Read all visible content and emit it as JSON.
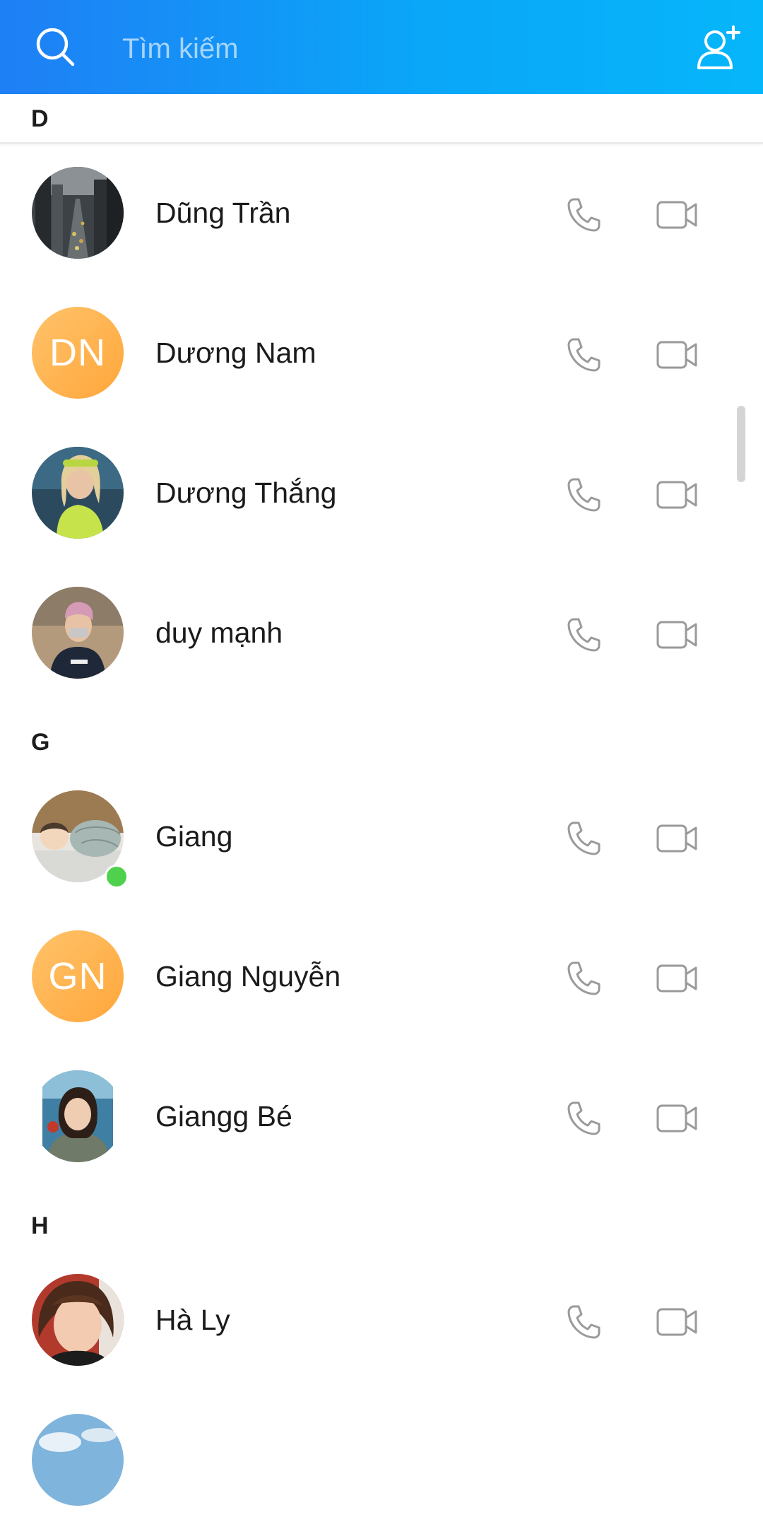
{
  "header": {
    "search_placeholder": "Tìm kiếm",
    "search_icon": "search-icon",
    "add_friend_icon": "add-friend-icon",
    "gradient_start": "#1f7ff5",
    "gradient_end": "#06b6fa"
  },
  "sections": [
    {
      "letter": "D",
      "contacts": [
        {
          "name": "Dũng Trần",
          "avatar": "photo"
        },
        {
          "name": "Dương Nam",
          "avatar": "initials",
          "initials": "DN"
        },
        {
          "name": "Dương Thắng",
          "avatar": "photo"
        },
        {
          "name": "duy mạnh",
          "avatar": "photo"
        }
      ]
    },
    {
      "letter": "G",
      "contacts": [
        {
          "name": "Giang",
          "avatar": "photo",
          "online": true
        },
        {
          "name": "Giang Nguyễn",
          "avatar": "initials",
          "initials": "GN"
        },
        {
          "name": "Giangg Bé",
          "avatar": "photo"
        }
      ]
    },
    {
      "letter": "H",
      "contacts": [
        {
          "name": "Hà Ly",
          "avatar": "photo"
        }
      ]
    }
  ],
  "row_actions": {
    "call_icon": "phone-icon",
    "video_icon": "video-camera-icon"
  },
  "colors": {
    "online": "#4fd14d",
    "initials_bg": "#ffa63a",
    "icon_gray": "#9a9a9a"
  }
}
